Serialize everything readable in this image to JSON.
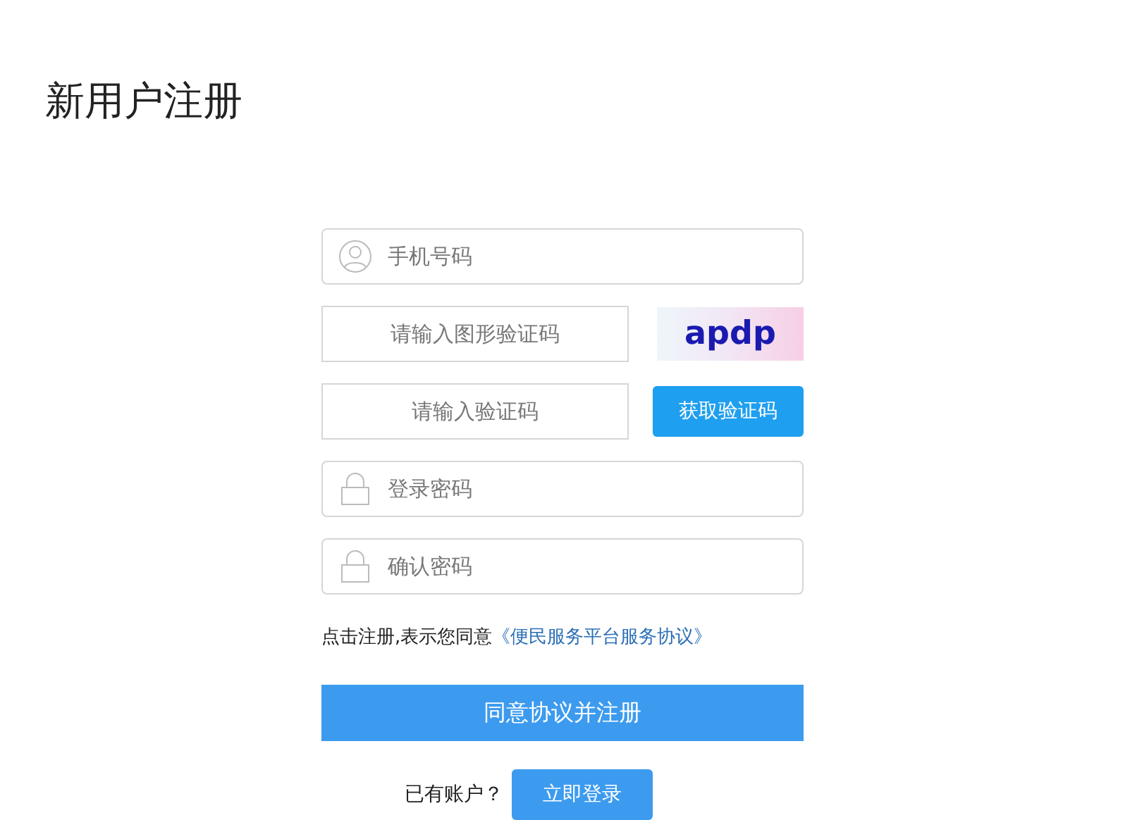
{
  "title": "新用户注册",
  "fields": [
    {
      "kind": "user",
      "placeholder": "手机号码"
    },
    {
      "kind": "captcha-image",
      "placeholder": "请输入图形验证码",
      "captcha": "apdp"
    },
    {
      "kind": "sms",
      "placeholder": "请输入验证码",
      "button": "获取验证码"
    },
    {
      "kind": "lock",
      "placeholder": "登录密码"
    },
    {
      "kind": "lock",
      "placeholder": "确认密码"
    }
  ],
  "agreement": {
    "text": "点击注册,表示您同意",
    "link": "《便民服务平台服务协议》"
  },
  "submit": "同意协议并注册",
  "login": {
    "prompt": "已有账户？",
    "button": "立即登录"
  }
}
